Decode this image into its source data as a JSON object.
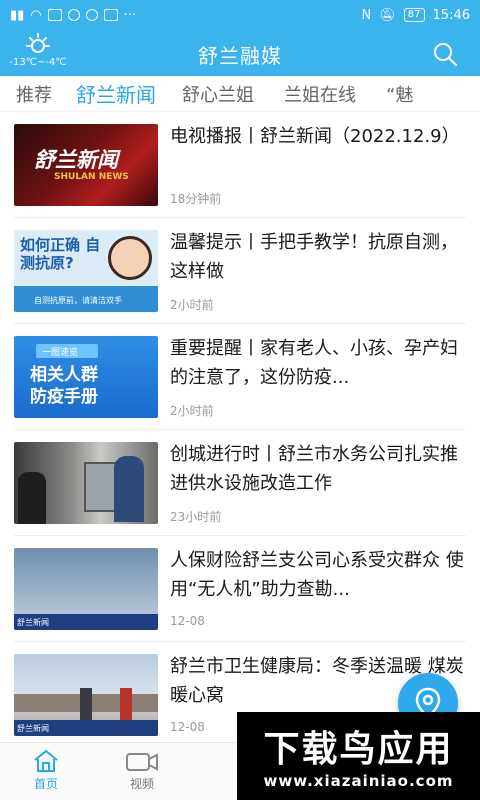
{
  "status_bar": {
    "battery": "87",
    "time": "15:46"
  },
  "header": {
    "weather_temp": "-13℃~-4℃",
    "title": "舒兰融媒"
  },
  "tabs": [
    "推荐",
    "舒兰新闻",
    "舒心兰姐",
    "兰姐在线",
    "“魅"
  ],
  "active_tab": 1,
  "news": [
    {
      "title": "电视播报丨舒兰新闻（2022.12.9）",
      "time": "18分钟前",
      "thumb_text": "舒兰新闻",
      "thumb_sub": "SHULAN NEWS"
    },
    {
      "title": "温馨提示丨手把手教学！抗原自测，这样做",
      "time": "2小时前",
      "thumb_text": "如何正确 自测抗原?",
      "thumb_sub": "自测抗原前，请清洁双手"
    },
    {
      "title": "重要提醒丨家有老人、小孩、孕产妇的注意了，这份防疫...",
      "time": "2小时前",
      "thumb_text": "相关人群 防疫手册",
      "thumb_sub": "一图速览"
    },
    {
      "title": "创城进行时丨舒兰市水务公司扎实推进供水设施改造工作",
      "time": "23小时前",
      "thumb_text": "",
      "thumb_sub": ""
    },
    {
      "title": "人保财险舒兰支公司心系受灾群众 使用“无人机”助力查勘...",
      "time": "12-08",
      "thumb_text": "舒兰新闻",
      "thumb_sub": ""
    },
    {
      "title": "舒兰市卫生健康局：冬季送温暖 煤炭暖心窝",
      "time": "12-08",
      "thumb_text": "舒兰新闻",
      "thumb_sub": ""
    }
  ],
  "bottom_nav": [
    {
      "label": "首页",
      "icon": "home-icon"
    },
    {
      "label": "视频",
      "icon": "video-camera-icon"
    }
  ],
  "watermark": {
    "title": "下载鸟应用",
    "url": "www.xiazainiao.com"
  },
  "colors": {
    "primary": "#3bb3ec",
    "active_tab": "#29a8e8"
  }
}
